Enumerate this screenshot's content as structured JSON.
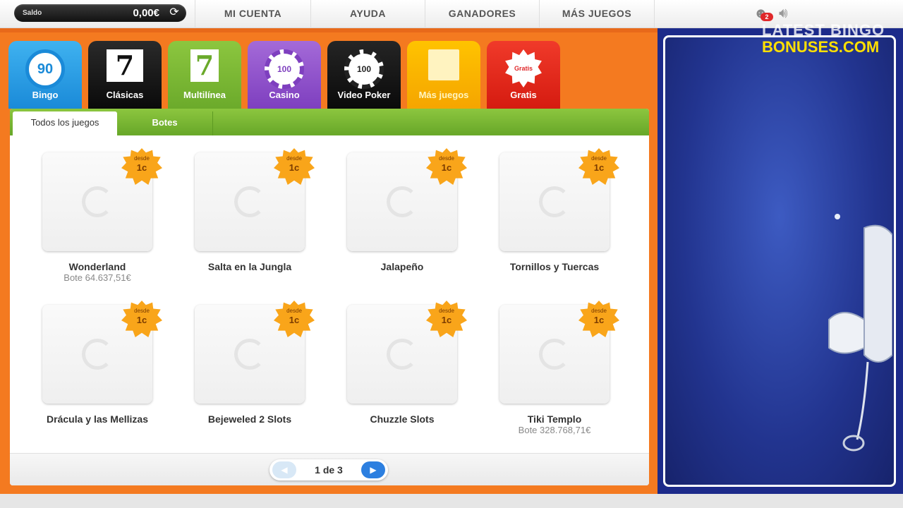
{
  "header": {
    "balance_label": "Saldo",
    "balance_value": "0,00€",
    "nav": [
      "MI CUENTA",
      "AYUDA",
      "GANADORES",
      "MÁS JUEGOS"
    ],
    "notification_count": "2"
  },
  "categories": [
    {
      "label": "Bingo",
      "icon_text": "90"
    },
    {
      "label": "Clásicas",
      "icon_text": "7"
    },
    {
      "label": "Multilínea",
      "icon_text": "7"
    },
    {
      "label": "Casino",
      "icon_text": "100"
    },
    {
      "label": "Video Poker",
      "icon_text": "100"
    },
    {
      "label": "Más juegos",
      "icon_text": ""
    },
    {
      "label": "Gratis",
      "icon_text": "Gratis"
    }
  ],
  "subtabs": {
    "all": "Todos los juegos",
    "jackpots": "Botes"
  },
  "badge": {
    "desde": "desde",
    "price": "1c"
  },
  "games": [
    {
      "name": "Wonderland",
      "jackpot": "Bote 64.637,51€"
    },
    {
      "name": "Salta en la Jungla",
      "jackpot": ""
    },
    {
      "name": "Jalapeño",
      "jackpot": ""
    },
    {
      "name": "Tornillos y Tuercas",
      "jackpot": ""
    },
    {
      "name": "Drácula y las Mellizas",
      "jackpot": ""
    },
    {
      "name": "Bejeweled 2 Slots",
      "jackpot": ""
    },
    {
      "name": "Chuzzle Slots",
      "jackpot": ""
    },
    {
      "name": "Tiki Templo",
      "jackpot": "Bote 328.768,71€"
    }
  ],
  "pager": {
    "text": "1 de 3"
  },
  "watermark": {
    "line1": "LATEST BINGO",
    "line2": "BONUSES.COM"
  },
  "colors": {
    "accent_orange": "#f47a20",
    "green": "#8cc63f",
    "panel_blue": "#1c2a8a"
  }
}
